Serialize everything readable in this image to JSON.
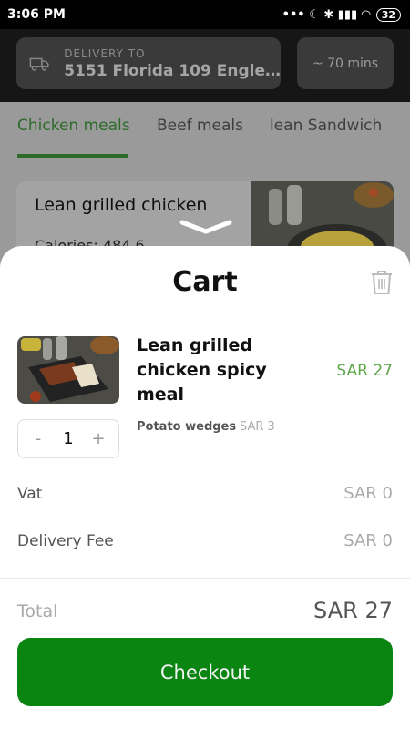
{
  "status_bar": {
    "time": "3:06 PM",
    "icons": "••• ☾ ✱ ▮▮▮ ◠",
    "battery": "32"
  },
  "header": {
    "delivery_label": "DELIVERY TO",
    "delivery_address": "5151 Florida 109 Engle…",
    "eta": "~ 70 mins"
  },
  "tabs": [
    {
      "label": "Chicken meals",
      "active": true
    },
    {
      "label": "Beef meals",
      "active": false
    },
    {
      "label": "lean Sandwich",
      "active": false
    }
  ],
  "meal_card": {
    "title": "Lean grilled chicken",
    "calories": "Calories: 484.6"
  },
  "cart": {
    "title": "Cart",
    "item": {
      "name": "Lean grilled chicken  spicy meal",
      "price": "SAR 27",
      "addon_name": "Potato wedges",
      "addon_price": "SAR 3",
      "quantity": "1",
      "minus": "-",
      "plus": "+"
    },
    "vat_label": "Vat",
    "vat_value": "SAR 0",
    "delivery_fee_label": "Delivery Fee",
    "delivery_fee_value": "SAR 0",
    "total_label": "Total",
    "total_value": "SAR 27",
    "checkout_label": "Checkout"
  },
  "colors": {
    "accent_green": "#0a8512",
    "price_green": "#5ea74a",
    "tab_active": "#2d6b2a"
  }
}
